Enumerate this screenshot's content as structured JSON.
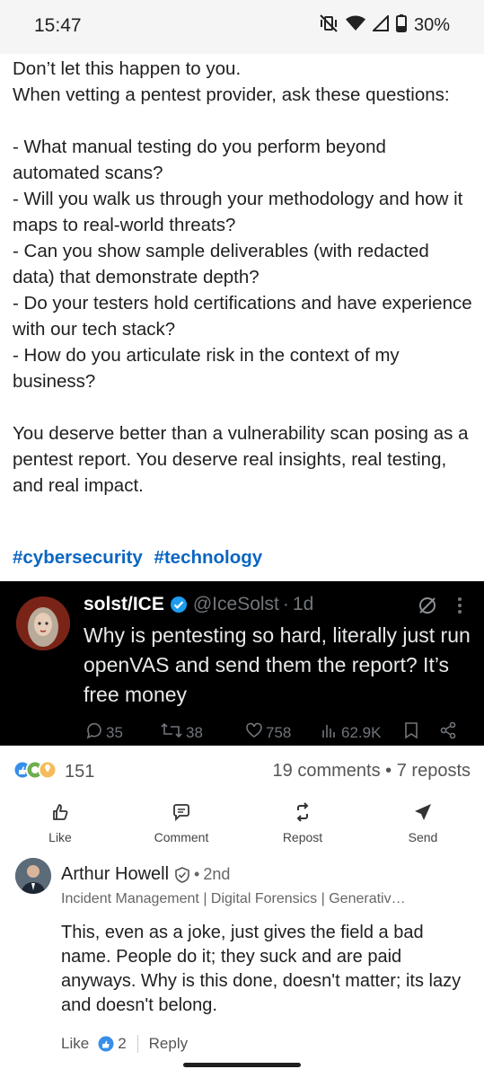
{
  "status_bar": {
    "time": "15:47",
    "battery": "30%"
  },
  "post": {
    "lines": [
      "Don’t let this happen to you.",
      "When vetting a pentest provider, ask these questions:",
      "",
      "- What manual testing do you perform beyond automated scans?",
      "- Will you walk us through your methodology and how it maps to real-world threats?",
      "- Can you show sample deliverables (with redacted data) that demonstrate depth?",
      "- Do your testers hold certifications and have experience with our tech stack?",
      "- How do you articulate risk in the context of my business?",
      "",
      "You deserve better than a vulnerability scan posing as a pentest report. You deserve real insights, real testing, and real impact."
    ],
    "hashtags": [
      "#cybersecurity",
      "#technology"
    ]
  },
  "tweet": {
    "name": "solst/ICE",
    "handle": "@IceSolst",
    "time": "1d",
    "text": "Why is pentesting so hard, literally just run openVAS and send them the report? It’s free money",
    "replies": "35",
    "retweets": "38",
    "likes": "758",
    "views": "62.9K"
  },
  "social": {
    "reactions_count": "151",
    "comments": "19 comments",
    "reposts": "7 reposts",
    "separator": "•"
  },
  "actions": {
    "like": "Like",
    "comment": "Comment",
    "repost": "Repost",
    "send": "Send"
  },
  "comment": {
    "name": "Arthur Howell",
    "degree": "2nd",
    "headline": "Incident Management | Digital Forensics | Generativ…",
    "text": "This, even as a joke, just gives the field a bad name. People do it; they suck and are paid anyways. Why is this done, doesn't matter; its lazy and doesn't belong.",
    "like_label": "Like",
    "like_count": "2",
    "reply_label": "Reply"
  },
  "colors": {
    "link": "#0a66c2",
    "tweet_bg": "#000000",
    "verified": "#1d9bf0"
  }
}
